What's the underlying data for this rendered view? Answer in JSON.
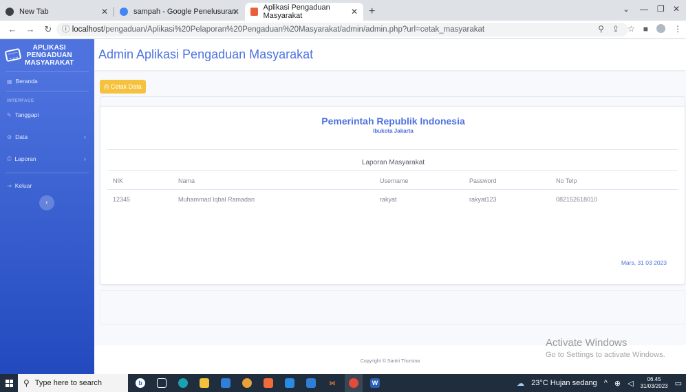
{
  "browser": {
    "tabs": [
      {
        "label": "New Tab",
        "active": false
      },
      {
        "label": "sampah - Google Penelusuran",
        "active": false
      },
      {
        "label": "Aplikasi Pengaduan Masyarakat",
        "active": true
      }
    ],
    "url_host": "localhost",
    "url_path": "/pengaduan/Aplikasi%20Pelaporan%20Pengaduan%20Masyarakat/admin/admin.php?url=cetak_masyarakat"
  },
  "sidebar": {
    "brand_line1": "APLIKASI",
    "brand_line2": "PENGADUAN",
    "brand_line3": "MASYARAKAT",
    "home_label": "Beranda",
    "heading": "INTERFACE",
    "items": [
      {
        "label": "Tanggapi",
        "icon": "edit-icon"
      },
      {
        "label": "Data",
        "icon": "gear-icon"
      },
      {
        "label": "Laporan",
        "icon": "print-icon"
      },
      {
        "label": "Keluar",
        "icon": "logout-icon"
      }
    ]
  },
  "header": {
    "title": "Admin Aplikasi Pengaduan Masyarakat"
  },
  "actions": {
    "print_label": "Cetak Data"
  },
  "report": {
    "gov_title": "Pemerintah Republik Indonesia",
    "gov_subtitle": "Ibukota Jakarta",
    "title": "Laporan Masyarakat",
    "columns": [
      "NIK",
      "Nama",
      "Username",
      "Password",
      "No Telp"
    ],
    "rows": [
      [
        "12345",
        "Muhammad Iqbal Ramadan",
        "rakyat",
        "rakyat123",
        "082152618010"
      ]
    ],
    "date": "Mars, 31 03 2023"
  },
  "footer": {
    "copyright": "Copyright © Santri Thursina"
  },
  "watermark": {
    "line1": "Activate Windows",
    "line2": "Go to Settings to activate Windows."
  },
  "taskbar": {
    "search_placeholder": "Type here to search",
    "weather": "23°C  Hujan sedang",
    "time": "06.45",
    "date": "31/03/2023"
  }
}
